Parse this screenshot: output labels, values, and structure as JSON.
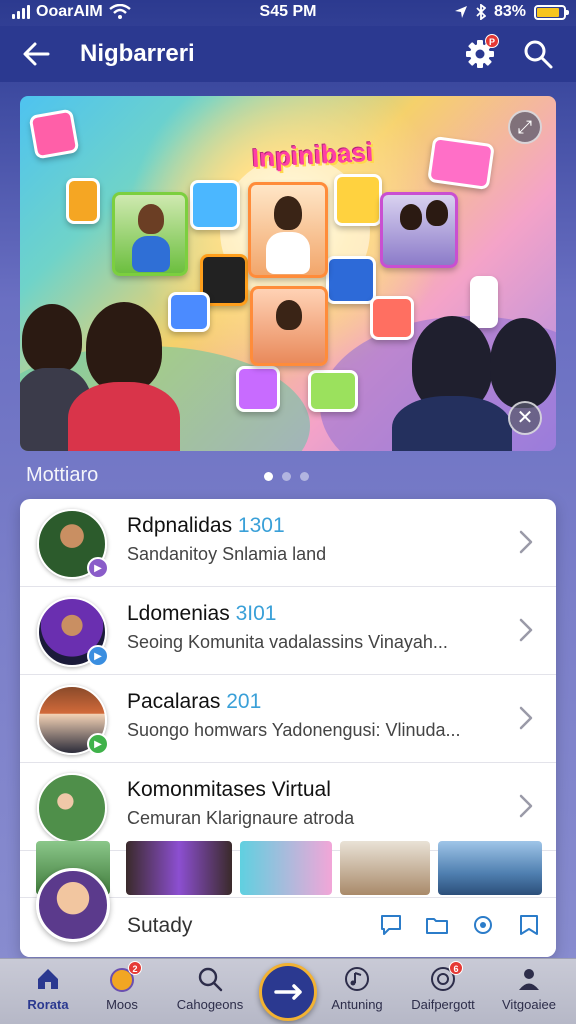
{
  "status_bar": {
    "carrier": "OoarAIM",
    "time": "S45 PM",
    "battery": "83%",
    "battery_level": 0.83
  },
  "header": {
    "title": "Nigbarreri",
    "settings_badge": "P"
  },
  "banner": {
    "title": "Inpinibasi"
  },
  "section": {
    "label": "Mottiaro",
    "pages": 3,
    "active_page": 0
  },
  "list": {
    "items": [
      {
        "title": "Rdpnalidas",
        "number": "1301",
        "subtitle": "Sandanitoy Snlamia land",
        "badge_color": "#8a5cc9"
      },
      {
        "title": "Ldomenias",
        "number": "3I01",
        "subtitle": "Seoing Komunita vadalassins Vinayah...",
        "badge_color": "#3a8ee0"
      },
      {
        "title": "Pacalaras",
        "number": "201",
        "subtitle": "Suongo homwars Yadonengusi: Vlinuda...",
        "badge_color": "#3fb24a"
      },
      {
        "title": "Komonmitases Virtual",
        "number": "",
        "subtitle": "Cemuran Klarignaure atroda",
        "badge_color": ""
      }
    ]
  },
  "compose": {
    "placeholder": "Sutady"
  },
  "bottom_nav": {
    "items": [
      {
        "label": "Rorata",
        "icon": "home-icon"
      },
      {
        "label": "Moos",
        "icon": "moon-icon",
        "badge": "2"
      },
      {
        "label": "Cahogeons",
        "icon": "search-icon"
      },
      {
        "label": "",
        "icon": "arrow-right-icon"
      },
      {
        "label": "Antuning",
        "icon": "music-icon"
      },
      {
        "label": "Daifpergott",
        "icon": "globe-icon",
        "badge": "6"
      },
      {
        "label": "Vitgoaiee",
        "icon": "profile-icon"
      }
    ]
  },
  "colors": {
    "header": "#2b3990",
    "accent": "#3aa0d8",
    "fab_ring": "#f2b233",
    "badge": "#e53935"
  }
}
